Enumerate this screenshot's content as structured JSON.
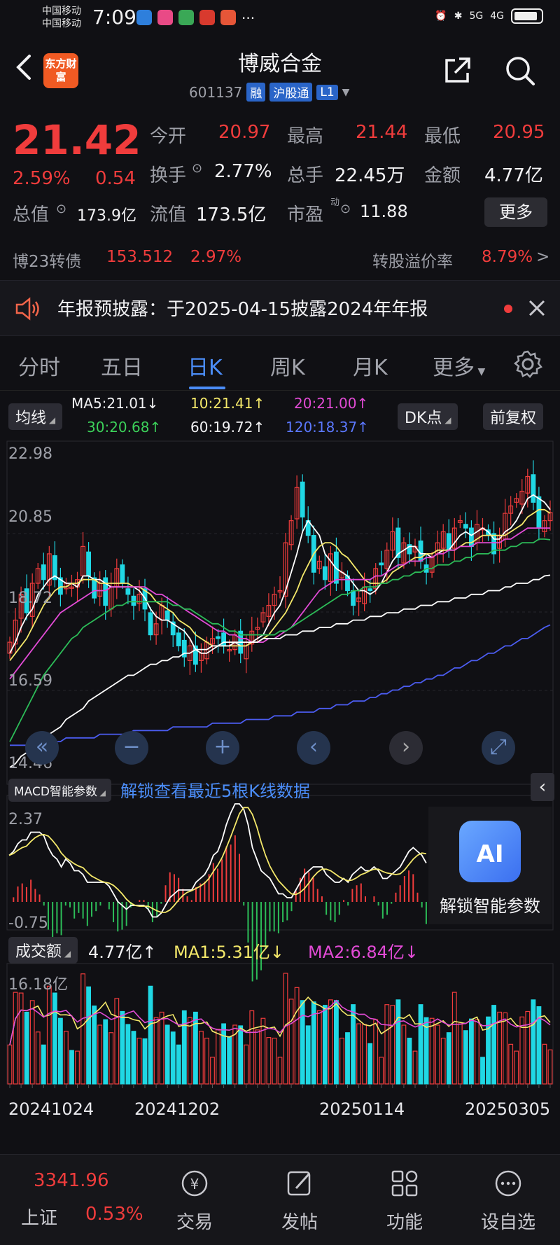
{
  "status_bar": {
    "carrier1": "中国移动",
    "carrier2": "中国移动",
    "time": "7:09",
    "dots": "···",
    "net": "5G",
    "net2": "4G"
  },
  "header": {
    "logo": "东方财富",
    "title": "博威合金",
    "code": "601137",
    "tag_rong": "融",
    "tag_hgt": "沪股通",
    "tag_l1": "L1"
  },
  "quote": {
    "price": "21.42",
    "pct": "2.59%",
    "change": "0.54",
    "open_label": "今开",
    "open": "20.97",
    "high_label": "最高",
    "high": "21.44",
    "low_label": "最低",
    "low": "20.95",
    "turnover_label": "换手",
    "turnover": "2.77%",
    "volume_label": "总手",
    "volume": "22.45万",
    "amount_label": "金额",
    "amount": "4.77亿",
    "mktcap_label": "总值",
    "mktcap": "173.9亿",
    "float_label": "流值",
    "float": "173.5亿",
    "pe_label": "市盈",
    "pe_sup": "动",
    "pe": "11.88",
    "more": "更多"
  },
  "bond": {
    "name": "博23转债",
    "price": "153.512",
    "pct": "2.97%",
    "premium_label": "转股溢价率",
    "premium": "8.79%"
  },
  "notice": {
    "text": "年报预披露：于2025-04-15披露2024年年报"
  },
  "tabs": [
    {
      "label": "分时"
    },
    {
      "label": "五日"
    },
    {
      "label": "日K"
    },
    {
      "label": "周K"
    },
    {
      "label": "月K"
    },
    {
      "label": "更多"
    }
  ],
  "ma_legend": {
    "selector": "均线",
    "ma5": "MA5:21.01↓",
    "ma10": "10:21.41↑",
    "ma20": "20:21.00↑",
    "ma30": "30:20.68↑",
    "ma60": "60:19.72↑",
    "ma120": "120:18.37↑",
    "dk": "DK点",
    "adjust": "前复权"
  },
  "macd": {
    "selector": "MACD智能参数",
    "unlock": "解锁查看最近5根K线数据",
    "ai_label": "解锁智能参数",
    "ai_icon": "AI"
  },
  "vol_legend": {
    "selector": "成交额",
    "v": "4.77亿↑",
    "ma1": "MA1:5.31亿↓",
    "ma2": "MA2:6.84亿↓"
  },
  "colors": {
    "up": "#f03c3c",
    "down": "#20d8e4",
    "ma5": "#ffffff",
    "ma10": "#f4e86a",
    "ma20": "#e24bd6",
    "ma30": "#2cbc58",
    "ma60": "#ffffff",
    "ma120": "#4b5cf0"
  },
  "chart_data": {
    "type": "candlestick",
    "y_ticks": [
      "22.98",
      "20.85",
      "18.72",
      "16.59",
      "14.46"
    ],
    "ylim": [
      14.46,
      22.98
    ],
    "macd_ticks": [
      "2.37",
      "-0.75"
    ],
    "vol_ticks": [
      "16.18亿"
    ],
    "vol_max": 16.18,
    "x_ticks": [
      "20241024",
      "20241202",
      "20250114",
      "20250305"
    ],
    "closes": [
      17.9,
      18.5,
      19.2,
      18.7,
      19.5,
      19.9,
      19.6,
      20.3,
      19.6,
      19.2,
      19.5,
      19.4,
      19.6,
      20.5,
      19.7,
      19.1,
      19.5,
      18.9,
      19.4,
      19.9,
      19.5,
      19.2,
      18.9,
      19.2,
      18.8,
      18.1,
      18.4,
      18.9,
      18.5,
      18.1,
      17.8,
      17.5,
      17.8,
      17.3,
      17.6,
      17.9,
      18.0,
      18.0,
      17.8,
      17.7,
      18.1,
      17.6,
      17.9,
      18.2,
      18.3,
      18.7,
      18.9,
      19.2,
      19.3,
      20.6,
      21.2,
      22.1,
      21.3,
      20.8,
      19.8,
      20.1,
      19.6,
      20.3,
      19.5,
      19.8,
      19.3,
      18.9,
      19.1,
      19.4,
      19.3,
      19.9,
      20.0,
      20.4,
      20.9,
      20.2,
      20.6,
      20.3,
      20.5,
      20.1,
      19.8,
      20.2,
      20.6,
      20.9,
      20.4,
      21.0,
      21.2,
      21.0,
      20.5,
      21.1,
      21.0,
      20.8,
      20.3,
      20.8,
      21.4,
      21.6,
      21.8,
      22.0,
      22.4,
      21.7,
      21.0,
      21.2,
      21.42
    ],
    "ma_series": [
      {
        "name": "MA5",
        "values": [
          17.6,
          17.9,
          18.3,
          18.6,
          18.8,
          19.2,
          19.4,
          19.6,
          19.7,
          19.6,
          19.5,
          19.5,
          19.4,
          19.7,
          19.7,
          19.6,
          19.6,
          19.5,
          19.4,
          19.4,
          19.4,
          19.4,
          19.4,
          19.3,
          19.1,
          18.8,
          18.6,
          18.5,
          18.5,
          18.4,
          18.3,
          18.2,
          18.0,
          17.7,
          17.6,
          17.6,
          17.7,
          17.8,
          17.9,
          17.9,
          17.9,
          17.8,
          17.8,
          17.9,
          18.0,
          18.1,
          18.4,
          18.7,
          18.9,
          19.3,
          19.8,
          20.3,
          20.9,
          21.2,
          21.0,
          20.8,
          20.3,
          20.1,
          19.9,
          19.8,
          19.7,
          19.5,
          19.3,
          19.3,
          19.2,
          19.3,
          19.5,
          19.8,
          20.1,
          20.3,
          20.4,
          20.5,
          20.5,
          20.3,
          20.3,
          20.2,
          20.3,
          20.4,
          20.4,
          20.6,
          20.8,
          20.9,
          20.8,
          20.9,
          21.0,
          20.9,
          20.7,
          20.7,
          20.9,
          21.0,
          21.2,
          21.5,
          21.8,
          21.9,
          21.8,
          21.7,
          21.5
        ]
      },
      {
        "name": "MA10",
        "values": [
          17.4,
          17.6,
          17.8,
          18.0,
          18.3,
          18.6,
          18.9,
          19.1,
          19.3,
          19.4,
          19.4,
          19.5,
          19.5,
          19.6,
          19.6,
          19.6,
          19.5,
          19.5,
          19.5,
          19.5,
          19.5,
          19.5,
          19.4,
          19.4,
          19.3,
          19.2,
          19.0,
          18.9,
          18.8,
          18.7,
          18.5,
          18.4,
          18.3,
          18.1,
          18.0,
          17.9,
          17.8,
          17.8,
          17.8,
          17.8,
          17.8,
          17.8,
          17.8,
          17.9,
          17.9,
          18.0,
          18.1,
          18.3,
          18.5,
          18.7,
          19.0,
          19.3,
          19.7,
          20.0,
          20.3,
          20.5,
          20.6,
          20.6,
          20.5,
          20.3,
          20.2,
          20.0,
          19.8,
          19.6,
          19.5,
          19.5,
          19.5,
          19.6,
          19.8,
          19.9,
          20.0,
          20.1,
          20.2,
          20.2,
          20.3,
          20.3,
          20.4,
          20.4,
          20.4,
          20.4,
          20.5,
          20.6,
          20.6,
          20.7,
          20.8,
          20.8,
          20.8,
          20.8,
          20.8,
          20.9,
          21.0,
          21.1,
          21.3,
          21.4,
          21.5,
          21.5,
          21.4
        ]
      },
      {
        "name": "MA20",
        "values": [
          16.9,
          17.1,
          17.3,
          17.5,
          17.7,
          17.9,
          18.1,
          18.3,
          18.5,
          18.7,
          18.8,
          18.9,
          19.0,
          19.1,
          19.2,
          19.3,
          19.3,
          19.3,
          19.4,
          19.4,
          19.4,
          19.4,
          19.4,
          19.4,
          19.4,
          19.3,
          19.2,
          19.2,
          19.1,
          19.0,
          18.9,
          18.8,
          18.7,
          18.6,
          18.5,
          18.4,
          18.3,
          18.2,
          18.2,
          18.1,
          18.1,
          18.0,
          18.0,
          17.9,
          17.9,
          17.9,
          18.0,
          18.0,
          18.1,
          18.2,
          18.3,
          18.5,
          18.7,
          18.9,
          19.1,
          19.3,
          19.4,
          19.5,
          19.6,
          19.6,
          19.6,
          19.6,
          19.6,
          19.6,
          19.6,
          19.7,
          19.7,
          19.8,
          19.9,
          20.0,
          20.0,
          20.1,
          20.1,
          20.1,
          20.2,
          20.2,
          20.3,
          20.3,
          20.4,
          20.4,
          20.5,
          20.5,
          20.5,
          20.6,
          20.6,
          20.6,
          20.6,
          20.6,
          20.7,
          20.7,
          20.8,
          20.9,
          21.0,
          21.0,
          21.0,
          21.0,
          21.0
        ]
      },
      {
        "name": "MA30",
        "values": [
          15.2,
          15.5,
          15.8,
          16.1,
          16.4,
          16.7,
          17.0,
          17.2,
          17.4,
          17.6,
          17.8,
          18.0,
          18.1,
          18.3,
          18.4,
          18.5,
          18.6,
          18.7,
          18.8,
          18.9,
          18.9,
          19.0,
          19.0,
          19.0,
          19.0,
          19.0,
          19.0,
          19.0,
          19.0,
          18.9,
          18.9,
          18.8,
          18.8,
          18.7,
          18.6,
          18.5,
          18.4,
          18.4,
          18.3,
          18.2,
          18.2,
          18.1,
          18.1,
          18.1,
          18.1,
          18.1,
          18.1,
          18.1,
          18.2,
          18.2,
          18.3,
          18.4,
          18.5,
          18.6,
          18.7,
          18.8,
          18.9,
          19.0,
          19.1,
          19.2,
          19.2,
          19.3,
          19.3,
          19.4,
          19.4,
          19.4,
          19.5,
          19.5,
          19.6,
          19.6,
          19.7,
          19.7,
          19.8,
          19.8,
          19.9,
          19.9,
          20.0,
          20.0,
          20.0,
          20.1,
          20.1,
          20.2,
          20.2,
          20.3,
          20.3,
          20.3,
          20.4,
          20.4,
          20.4,
          20.5,
          20.5,
          20.6,
          20.6,
          20.6,
          20.7,
          20.7,
          20.68
        ]
      },
      {
        "name": "MA60",
        "values": [
          14.5,
          14.6,
          14.8,
          14.9,
          15.0,
          15.1,
          15.3,
          15.4,
          15.5,
          15.6,
          15.8,
          15.9,
          16.0,
          16.1,
          16.3,
          16.4,
          16.5,
          16.6,
          16.7,
          16.8,
          16.9,
          17.0,
          17.0,
          17.1,
          17.2,
          17.3,
          17.3,
          17.4,
          17.4,
          17.5,
          17.5,
          17.6,
          17.6,
          17.7,
          17.7,
          17.7,
          17.8,
          17.8,
          17.8,
          17.8,
          17.9,
          17.9,
          17.9,
          17.9,
          17.9,
          18.0,
          18.0,
          18.0,
          18.0,
          18.1,
          18.1,
          18.1,
          18.2,
          18.2,
          18.2,
          18.3,
          18.3,
          18.3,
          18.4,
          18.4,
          18.4,
          18.5,
          18.5,
          18.5,
          18.6,
          18.6,
          18.6,
          18.7,
          18.7,
          18.7,
          18.8,
          18.8,
          18.8,
          18.9,
          18.9,
          18.9,
          19.0,
          19.0,
          19.0,
          19.1,
          19.1,
          19.1,
          19.2,
          19.2,
          19.2,
          19.3,
          19.3,
          19.3,
          19.4,
          19.4,
          19.5,
          19.5,
          19.5,
          19.6,
          19.6,
          19.7,
          19.72
        ]
      },
      {
        "name": "MA120",
        "values": [
          15.1,
          15.1,
          15.1,
          15.1,
          15.2,
          15.2,
          15.2,
          15.2,
          15.2,
          15.2,
          15.3,
          15.3,
          15.3,
          15.3,
          15.3,
          15.3,
          15.4,
          15.4,
          15.4,
          15.4,
          15.4,
          15.4,
          15.5,
          15.5,
          15.5,
          15.5,
          15.5,
          15.5,
          15.5,
          15.6,
          15.6,
          15.6,
          15.6,
          15.6,
          15.6,
          15.6,
          15.7,
          15.7,
          15.7,
          15.7,
          15.7,
          15.7,
          15.8,
          15.8,
          15.8,
          15.8,
          15.8,
          15.9,
          15.9,
          15.9,
          15.9,
          16.0,
          16.0,
          16.0,
          16.0,
          16.1,
          16.1,
          16.1,
          16.2,
          16.2,
          16.2,
          16.3,
          16.3,
          16.3,
          16.4,
          16.4,
          16.5,
          16.5,
          16.6,
          16.6,
          16.7,
          16.7,
          16.8,
          16.8,
          16.9,
          16.9,
          17.0,
          17.0,
          17.1,
          17.2,
          17.2,
          17.3,
          17.4,
          17.4,
          17.5,
          17.6,
          17.6,
          17.7,
          17.8,
          17.8,
          17.9,
          18.0,
          18.0,
          18.1,
          18.2,
          18.3,
          18.37
        ]
      }
    ]
  },
  "bottom_nav": {
    "index_value": "3341.96",
    "index_name": "上证",
    "index_pct": "0.53%",
    "items": [
      {
        "label": "交易"
      },
      {
        "label": "发帖"
      },
      {
        "label": "功能"
      },
      {
        "label": "设自选"
      }
    ]
  }
}
